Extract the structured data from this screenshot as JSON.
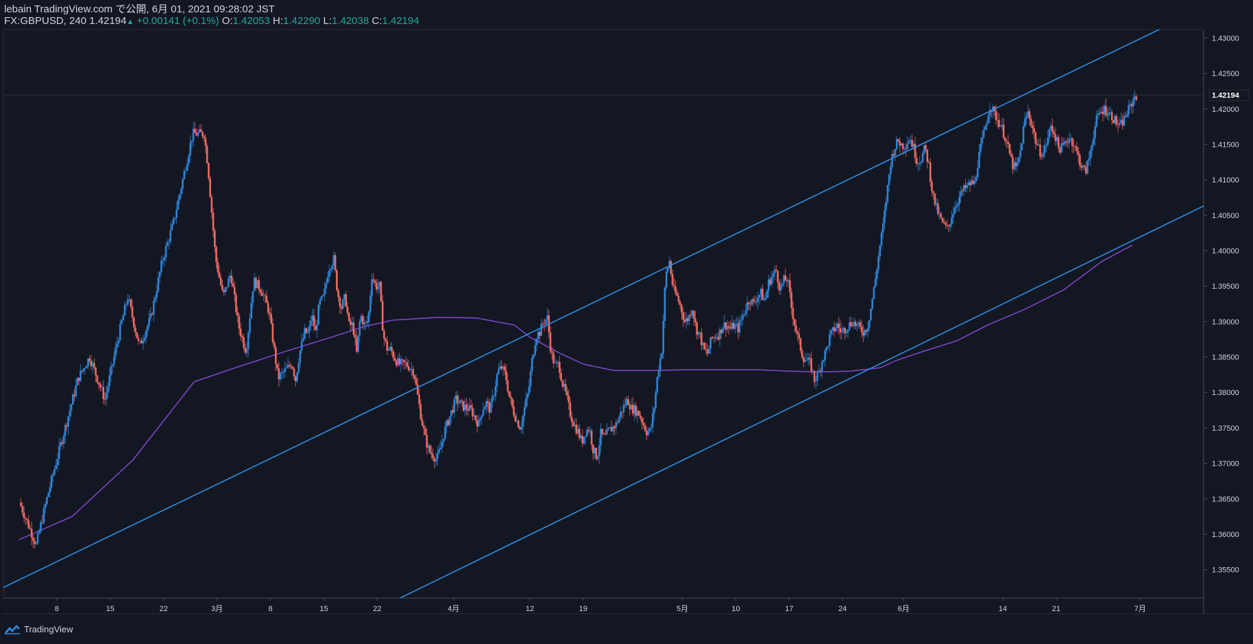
{
  "header": {
    "line1": "lebain TradingView.com で公開, 6月 01, 2021 09:28:02 JST",
    "symbol": "FX:GBPUSD, 240",
    "last": "1.42194",
    "change": "+0.00141 (+0.1%)",
    "o_label": "O:",
    "o_value": "1.42053",
    "h_label": "H:",
    "h_value": "1.42290",
    "l_label": "L:",
    "l_value": "1.42038",
    "c_label": "C:",
    "c_value": "1.42194"
  },
  "footer": {
    "brand": "TradingView"
  },
  "colors": {
    "background": "#131722",
    "candle_up": "#2f84d8",
    "candle_down": "#ef6a63",
    "channel": "#2e8fe6",
    "ma": "#7b45c6",
    "text": "#d1d4dc",
    "value_up": "#26a69a"
  },
  "chart_data": {
    "type": "line",
    "symbol": "FX:GBPUSD",
    "timeframe": "240",
    "ylim": [
      1.351,
      1.4312
    ],
    "last_price": "1.42194",
    "y_ticks": [
      {
        "value": 1.43,
        "label": "1.43000"
      },
      {
        "value": 1.425,
        "label": "1.42500"
      },
      {
        "value": 1.42,
        "label": "1.42000"
      },
      {
        "value": 1.415,
        "label": "1.41500"
      },
      {
        "value": 1.41,
        "label": "1.41000"
      },
      {
        "value": 1.405,
        "label": "1.40500"
      },
      {
        "value": 1.4,
        "label": "1.40000"
      },
      {
        "value": 1.395,
        "label": "1.39500"
      },
      {
        "value": 1.39,
        "label": "1.39000"
      },
      {
        "value": 1.385,
        "label": "1.38500"
      },
      {
        "value": 1.38,
        "label": "1.38000"
      },
      {
        "value": 1.375,
        "label": "1.37500"
      },
      {
        "value": 1.37,
        "label": "1.37000"
      },
      {
        "value": 1.365,
        "label": "1.36500"
      },
      {
        "value": 1.36,
        "label": "1.36000"
      },
      {
        "value": 1.355,
        "label": "1.35500"
      }
    ],
    "x_ticks": [
      {
        "day": 8,
        "label": "8"
      },
      {
        "day": 15,
        "label": "15"
      },
      {
        "day": 22,
        "label": "22"
      },
      {
        "day": 29,
        "label": "3月"
      },
      {
        "day": 36,
        "label": "8"
      },
      {
        "day": 43,
        "label": "15"
      },
      {
        "day": 50,
        "label": "22"
      },
      {
        "day": 60,
        "label": "4月"
      },
      {
        "day": 70,
        "label": "12"
      },
      {
        "day": 77,
        "label": "19"
      },
      {
        "day": 90,
        "label": "5月"
      },
      {
        "day": 97,
        "label": "10"
      },
      {
        "day": 104,
        "label": "17"
      },
      {
        "day": 111,
        "label": "24"
      },
      {
        "day": 119,
        "label": "6月"
      },
      {
        "day": 132,
        "label": "14"
      },
      {
        "day": 139,
        "label": "21"
      },
      {
        "day": 150,
        "label": "7月"
      }
    ],
    "price_path": [
      [
        3.3,
        1.3645
      ],
      [
        5.5,
        1.3585
      ],
      [
        7,
        1.3655
      ],
      [
        8.5,
        1.3718
      ],
      [
        11,
        1.382
      ],
      [
        12.5,
        1.385
      ],
      [
        14.5,
        1.379
      ],
      [
        16.5,
        1.389
      ],
      [
        17.5,
        1.3935
      ],
      [
        19,
        1.3865
      ],
      [
        20.5,
        1.3905
      ],
      [
        22,
        1.3985
      ],
      [
        23.5,
        1.404
      ],
      [
        26,
        1.4165
      ],
      [
        27.5,
        1.4165
      ],
      [
        28,
        1.412
      ],
      [
        29,
        1.399
      ],
      [
        30,
        1.3935
      ],
      [
        31,
        1.3968
      ],
      [
        32,
        1.3895
      ],
      [
        33,
        1.3858
      ],
      [
        34,
        1.3958
      ],
      [
        35,
        1.3945
      ],
      [
        36,
        1.3915
      ],
      [
        37.2,
        1.382
      ],
      [
        38.5,
        1.3835
      ],
      [
        39,
        1.3842
      ],
      [
        39.5,
        1.3818
      ],
      [
        40,
        1.3855
      ],
      [
        40.7,
        1.3885
      ],
      [
        41.2,
        1.3883
      ],
      [
        41.6,
        1.391
      ],
      [
        42.1,
        1.3885
      ],
      [
        42.6,
        1.3925
      ],
      [
        43.2,
        1.3935
      ],
      [
        43.8,
        1.3975
      ],
      [
        44.5,
        1.3988
      ],
      [
        45,
        1.394
      ],
      [
        45.5,
        1.392
      ],
      [
        46,
        1.3935
      ],
      [
        46.5,
        1.3895
      ],
      [
        47,
        1.3895
      ],
      [
        47.5,
        1.3855
      ],
      [
        48,
        1.391
      ],
      [
        48.5,
        1.3895
      ],
      [
        49,
        1.39
      ],
      [
        49.5,
        1.3965
      ],
      [
        50,
        1.395
      ],
      [
        50.5,
        1.395
      ],
      [
        51,
        1.388
      ],
      [
        51.5,
        1.3862
      ],
      [
        52,
        1.386
      ],
      [
        52.5,
        1.3848
      ],
      [
        53,
        1.384
      ],
      [
        54,
        1.384
      ],
      [
        55,
        1.383
      ],
      [
        55.5,
        1.3795
      ],
      [
        56,
        1.3762
      ],
      [
        56.5,
        1.3735
      ],
      [
        57,
        1.3717
      ],
      [
        57.5,
        1.3712
      ],
      [
        58,
        1.3705
      ],
      [
        58.5,
        1.3722
      ],
      [
        59,
        1.3745
      ],
      [
        59.5,
        1.376
      ],
      [
        60,
        1.3775
      ],
      [
        60.5,
        1.379
      ],
      [
        61,
        1.3785
      ],
      [
        61.5,
        1.378
      ],
      [
        62,
        1.3778
      ],
      [
        62.5,
        1.3775
      ],
      [
        63,
        1.3765
      ],
      [
        63.5,
        1.3755
      ],
      [
        64,
        1.3778
      ],
      [
        64.5,
        1.3785
      ],
      [
        65,
        1.3775
      ],
      [
        65.5,
        1.38
      ],
      [
        66,
        1.383
      ],
      [
        66.5,
        1.3835
      ],
      [
        67,
        1.3825
      ],
      [
        67.5,
        1.3795
      ],
      [
        68,
        1.3775
      ],
      [
        68.5,
        1.376
      ],
      [
        69,
        1.375
      ],
      [
        69.5,
        1.3778
      ],
      [
        70,
        1.38
      ],
      [
        70.5,
        1.3845
      ],
      [
        71,
        1.388
      ],
      [
        71.5,
        1.3885
      ],
      [
        72,
        1.39
      ],
      [
        72.5,
        1.3905
      ],
      [
        73,
        1.3855
      ],
      [
        73.5,
        1.3838
      ],
      [
        74,
        1.384
      ],
      [
        74.5,
        1.3812
      ],
      [
        75,
        1.3795
      ],
      [
        75.5,
        1.377
      ],
      [
        76,
        1.3755
      ],
      [
        76.5,
        1.3745
      ],
      [
        77,
        1.373
      ],
      [
        77.5,
        1.3745
      ],
      [
        78,
        1.375
      ],
      [
        78.5,
        1.372
      ],
      [
        79,
        1.3708
      ],
      [
        79.5,
        1.3742
      ],
      [
        80,
        1.3735
      ],
      [
        80.5,
        1.3745
      ],
      [
        81,
        1.375
      ],
      [
        81.5,
        1.3755
      ],
      [
        82,
        1.3768
      ],
      [
        82.5,
        1.378
      ],
      [
        83,
        1.379
      ],
      [
        83.5,
        1.3778
      ],
      [
        84,
        1.3775
      ],
      [
        84.5,
        1.377
      ],
      [
        85,
        1.3758
      ],
      [
        85.5,
        1.3745
      ],
      [
        86,
        1.3745
      ],
      [
        86.5,
        1.378
      ],
      [
        87,
        1.383
      ],
      [
        87.5,
        1.386
      ],
      [
        88,
        1.3965
      ],
      [
        88.5,
        1.3985
      ],
      [
        89,
        1.3945
      ],
      [
        89.5,
        1.3935
      ],
      [
        90,
        1.392
      ],
      [
        90.5,
        1.39
      ],
      [
        91,
        1.3905
      ],
      [
        91.5,
        1.392
      ],
      [
        92,
        1.389
      ],
      [
        92.5,
        1.388
      ],
      [
        93,
        1.386
      ],
      [
        93.5,
        1.3855
      ],
      [
        94,
        1.3875
      ],
      [
        94.5,
        1.388
      ],
      [
        95,
        1.3882
      ],
      [
        95.5,
        1.3895
      ],
      [
        96,
        1.3895
      ],
      [
        96.5,
        1.389
      ],
      [
        97,
        1.3895
      ],
      [
        97.5,
        1.389
      ],
      [
        98,
        1.3905
      ],
      [
        98.5,
        1.392
      ],
      [
        99,
        1.3932
      ],
      [
        99.5,
        1.3925
      ],
      [
        100,
        1.3935
      ],
      [
        100.5,
        1.394
      ],
      [
        101,
        1.3928
      ],
      [
        101.5,
        1.3955
      ],
      [
        102,
        1.3965
      ],
      [
        102.5,
        1.3972
      ],
      [
        103,
        1.3945
      ],
      [
        103.5,
        1.3958
      ],
      [
        104,
        1.396
      ],
      [
        104.5,
        1.392
      ],
      [
        105,
        1.3892
      ],
      [
        105.5,
        1.387
      ],
      [
        106,
        1.385
      ],
      [
        106.5,
        1.3845
      ],
      [
        107,
        1.384
      ],
      [
        107.5,
        1.3818
      ],
      [
        108,
        1.3825
      ],
      [
        108.5,
        1.3845
      ],
      [
        109,
        1.3858
      ],
      [
        109.5,
        1.3878
      ],
      [
        110,
        1.3888
      ],
      [
        110.5,
        1.3895
      ],
      [
        111,
        1.3885
      ],
      [
        111.5,
        1.389
      ],
      [
        112,
        1.3895
      ],
      [
        112.5,
        1.39
      ],
      [
        113,
        1.3895
      ],
      [
        113.5,
        1.389
      ],
      [
        114,
        1.3885
      ],
      [
        114.5,
        1.3895
      ],
      [
        115,
        1.3925
      ],
      [
        115.5,
        1.396
      ],
      [
        116,
        1.4
      ],
      [
        116.5,
        1.4035
      ],
      [
        117,
        1.408
      ],
      [
        117.5,
        1.4125
      ],
      [
        118,
        1.4145
      ],
      [
        118.5,
        1.4155
      ],
      [
        119,
        1.4148
      ],
      [
        119.5,
        1.415
      ],
      [
        120,
        1.416
      ],
      [
        120.5,
        1.4145
      ],
      [
        121,
        1.4125
      ],
      [
        121.5,
        1.413
      ],
      [
        122,
        1.4145
      ],
      [
        122.5,
        1.412
      ],
      [
        123,
        1.408
      ],
      [
        123.5,
        1.406
      ],
      [
        124,
        1.4045
      ],
      [
        124.5,
        1.4035
      ],
      [
        125,
        1.403
      ],
      [
        125.5,
        1.405
      ],
      [
        126,
        1.4065
      ],
      [
        126.5,
        1.4075
      ],
      [
        127,
        1.4085
      ],
      [
        127.5,
        1.409
      ],
      [
        128,
        1.4095
      ],
      [
        128.5,
        1.4095
      ],
      [
        129,
        1.413
      ],
      [
        129.5,
        1.4155
      ],
      [
        130,
        1.418
      ],
      [
        130.5,
        1.4205
      ],
      [
        131,
        1.4195
      ],
      [
        131.5,
        1.4185
      ],
      [
        132,
        1.4175
      ],
      [
        132.5,
        1.416
      ],
      [
        133,
        1.414
      ],
      [
        133.5,
        1.412
      ],
      [
        134,
        1.4115
      ],
      [
        134.5,
        1.414
      ],
      [
        135,
        1.418
      ],
      [
        135.5,
        1.4195
      ],
      [
        136,
        1.4178
      ],
      [
        136.5,
        1.4155
      ],
      [
        137,
        1.414
      ],
      [
        137.5,
        1.4138
      ],
      [
        138,
        1.4155
      ],
      [
        138.5,
        1.4175
      ],
      [
        139,
        1.4165
      ],
      [
        139.5,
        1.4145
      ],
      [
        140,
        1.4145
      ],
      [
        140.5,
        1.4155
      ],
      [
        141,
        1.416
      ],
      [
        141.5,
        1.415
      ],
      [
        142,
        1.4135
      ],
      [
        142.5,
        1.412
      ],
      [
        143,
        1.411
      ],
      [
        143.5,
        1.413
      ],
      [
        144,
        1.416
      ],
      [
        144.5,
        1.4185
      ],
      [
        145,
        1.4195
      ],
      [
        145.5,
        1.42
      ],
      [
        146,
        1.4195
      ],
      [
        146.5,
        1.419
      ],
      [
        147,
        1.4182
      ],
      [
        147.5,
        1.4175
      ],
      [
        148,
        1.4183
      ],
      [
        148.5,
        1.4195
      ],
      [
        149,
        1.4205
      ],
      [
        149.5,
        1.4219
      ]
    ],
    "moving_average": [
      [
        3,
        1.3592
      ],
      [
        10,
        1.3625
      ],
      [
        18,
        1.3705
      ],
      [
        26,
        1.3815
      ],
      [
        32,
        1.3837
      ],
      [
        38,
        1.3858
      ],
      [
        44,
        1.3878
      ],
      [
        48,
        1.3892
      ],
      [
        52,
        1.3902
      ],
      [
        58,
        1.3906
      ],
      [
        63,
        1.3905
      ],
      [
        68,
        1.3895
      ],
      [
        70,
        1.3878
      ],
      [
        74,
        1.3855
      ],
      [
        77,
        1.384
      ],
      [
        81,
        1.3831
      ],
      [
        86,
        1.3831
      ],
      [
        90,
        1.3832
      ],
      [
        95,
        1.3832
      ],
      [
        100,
        1.3832
      ],
      [
        104,
        1.383
      ],
      [
        108,
        1.3829
      ],
      [
        112,
        1.383
      ],
      [
        116,
        1.3835
      ],
      [
        118,
        1.3845
      ],
      [
        121,
        1.3856
      ],
      [
        126,
        1.3873
      ],
      [
        130,
        1.3895
      ],
      [
        135,
        1.3918
      ],
      [
        140,
        1.3945
      ],
      [
        145,
        1.3985
      ],
      [
        149,
        1.4008
      ]
    ],
    "channel_lines": [
      {
        "from": [
          1,
          1.3525
        ],
        "to": [
          155,
          1.4325
        ]
      },
      {
        "from": [
          53,
          1.351
        ],
        "to": [
          192,
          1.424
        ]
      }
    ]
  }
}
